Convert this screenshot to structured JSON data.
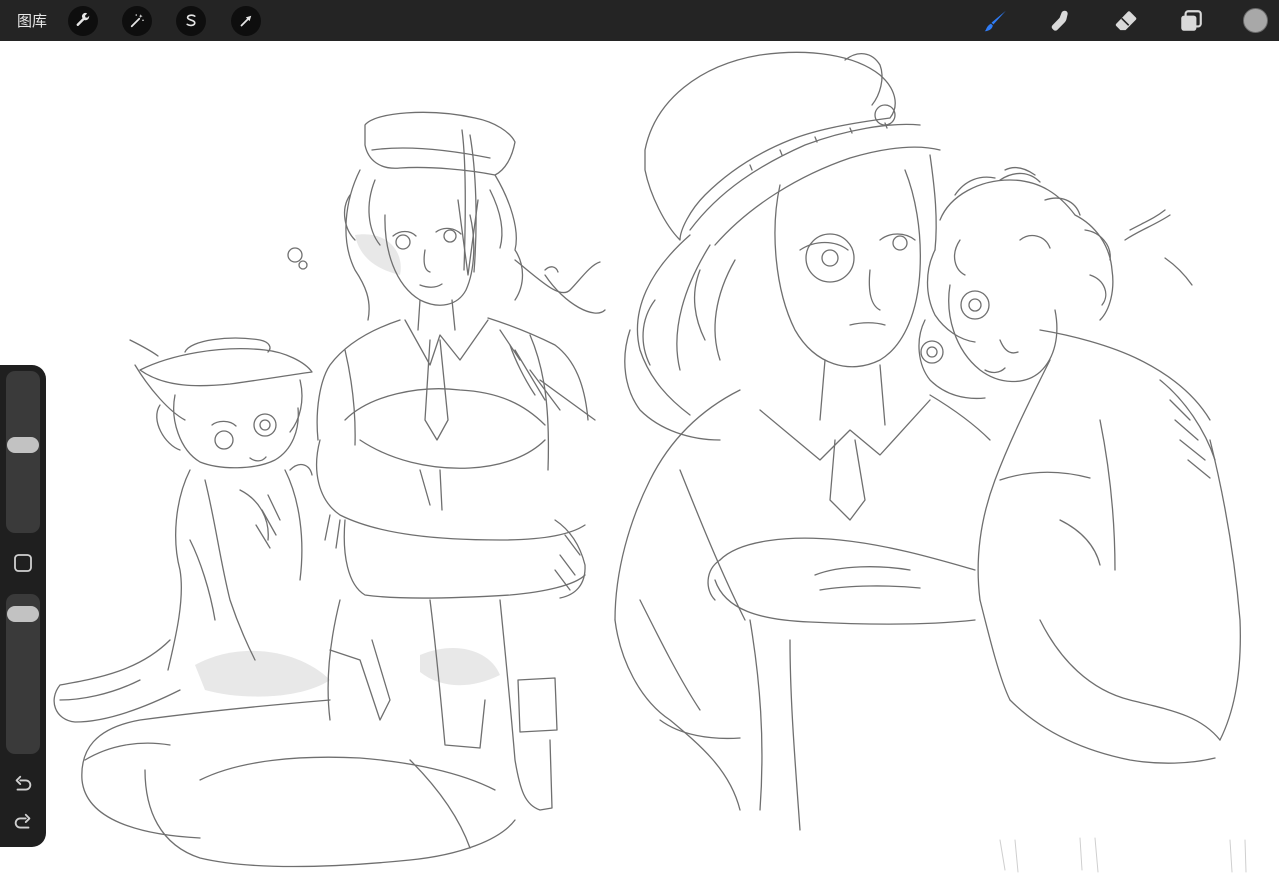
{
  "toolbar": {
    "gallery_label": "图库",
    "left_tools": [
      {
        "name": "actions",
        "icon": "wrench-icon"
      },
      {
        "name": "adjustments",
        "icon": "magic-wand-icon"
      },
      {
        "name": "selection",
        "icon": "selection-s-icon"
      },
      {
        "name": "transform",
        "icon": "arrow-cursor-icon"
      }
    ],
    "right_tools": [
      {
        "name": "brush",
        "icon": "paintbrush-icon",
        "active": true
      },
      {
        "name": "smudge",
        "icon": "smudge-finger-icon",
        "active": false
      },
      {
        "name": "eraser",
        "icon": "eraser-icon",
        "active": false
      },
      {
        "name": "layers",
        "icon": "layers-icon",
        "active": false
      }
    ],
    "current_color": "#a8a8a8"
  },
  "sidebar": {
    "brush_size_level": 0.55,
    "opacity_level": 0.08,
    "modify_icon": "square-outline-icon",
    "undo_icon": "undo-arrow-icon",
    "redo_icon": "redo-arrow-icon"
  },
  "colors": {
    "toolbar_bg": "#242424",
    "sidebar_bg": "#1f1f1f",
    "accent_active": "#2f7cf6",
    "canvas_bg": "#ffffff",
    "sketch_line": "#6f6f6f"
  }
}
